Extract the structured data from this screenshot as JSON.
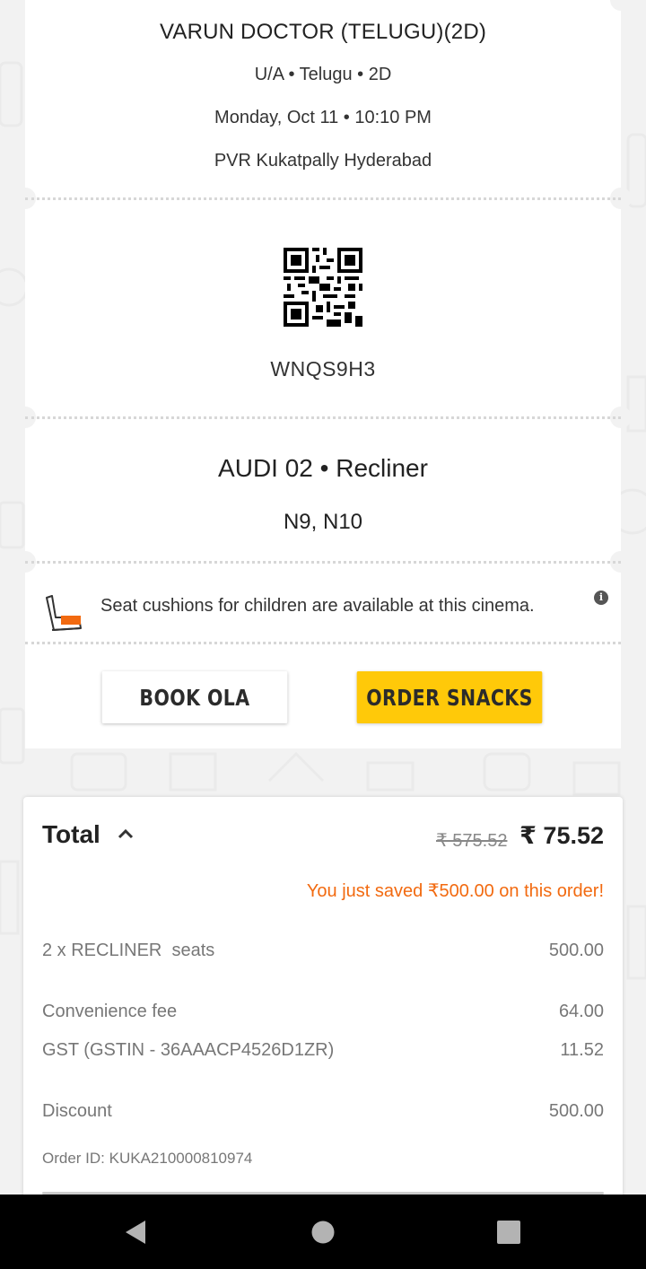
{
  "movie": {
    "title": "VARUN DOCTOR (TELUGU)(2D)",
    "format_line": "U/A • Telugu • 2D",
    "showtime": "Monday, Oct 11 • 10:10 PM",
    "cinema": "PVR Kukatpally Hyderabad"
  },
  "booking": {
    "code": "WNQS9H3",
    "audi": "AUDI 02 • Recliner",
    "seats": "N9, N10"
  },
  "notice": {
    "text": "Seat cushions for children are available at this cinema.",
    "icon": "child-seat-icon",
    "info_icon_glyph": "i"
  },
  "actions": {
    "book_ola": "BOOK OLA",
    "order_snacks": "ORDER SNACKS"
  },
  "summary": {
    "total_label": "Total",
    "original_amount": "₹ 575.52",
    "total_amount": "₹ 75.52",
    "saved_message": "You just saved ₹500.00 on this order!",
    "lines": [
      {
        "label": "2 x RECLINER  seats",
        "amount": "500.00"
      },
      {
        "label": "Convenience fee",
        "amount": "64.00"
      },
      {
        "label": "GST (GSTIN - 36AAACP4526D1ZR)",
        "amount": "11.52"
      },
      {
        "label": "Discount",
        "amount": "500.00"
      }
    ],
    "order_id": "Order ID: KUKA210000810974"
  },
  "colors": {
    "accent_yellow": "#ffc909",
    "saved_orange": "#f26a10",
    "background": "#f2f2f2"
  },
  "navbar": {
    "back": "back-icon",
    "home": "home-icon",
    "recents": "recents-icon"
  }
}
